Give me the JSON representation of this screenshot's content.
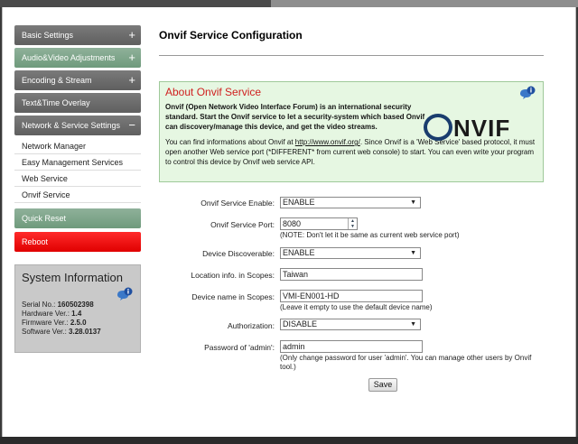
{
  "sidebar": {
    "menu": [
      {
        "label": "Basic Settings",
        "icon": "plus-icon",
        "glyph": "+"
      },
      {
        "label": "Audio&Video Adjustments",
        "icon": "plus-icon",
        "glyph": "+"
      },
      {
        "label": "Encoding & Stream",
        "icon": "plus-icon",
        "glyph": "+"
      },
      {
        "label": "Text&Time Overlay"
      },
      {
        "label": "Network & Service Settings",
        "icon": "minus-icon",
        "glyph": "−"
      }
    ],
    "submenu": [
      "Network Manager",
      "Easy Management Services",
      "Web Service",
      "Onvif Service"
    ],
    "quick_reset": "Quick Reset",
    "reboot": "Reboot"
  },
  "sysinfo": {
    "title": "System Information",
    "serial_label": "Serial No.:",
    "serial": "160502398",
    "hardware_label": "Hardware Ver.:",
    "hardware": "1.4",
    "firmware_label": "Firmware Ver.:",
    "firmware": "2.5.0",
    "software_label": "Software Ver.:",
    "software": "3.28.0137"
  },
  "main": {
    "title": "Onvif Service Configuration",
    "about": {
      "title": "About Onvif Service",
      "desc": "Onvif (Open Network Video Interface Forum) is an international security standard. Start the Onvif service to let a security-system which based Onvif can discovery/manage this device, and get the video streams.",
      "info_pre": "You can find informations about Onvif at ",
      "info_link": "http://www.onvif.org/",
      "info_post": ". Since Onvif is a 'Web Service' based protocol, it must open another Web service port (*DIFFERENT* from current web console) to start. You can even write your program to control this device by Onvif web service API.",
      "logo_rest": "NVIF"
    },
    "form": {
      "enable_label": "Onvif Service Enable:",
      "enable_value": "ENABLE",
      "port_label": "Onvif Service Port:",
      "port_value": "8080",
      "port_note": "(NOTE: Don't let it be same as current web service port)",
      "discover_label": "Device Discoverable:",
      "discover_value": "ENABLE",
      "location_label": "Location info. in Scopes:",
      "location_value": "Taiwan",
      "name_label": "Device name in Scopes:",
      "name_value": "VMI-EN001-HD",
      "name_note": "(Leave it empty to use the default device name)",
      "auth_label": "Authorization:",
      "auth_value": "DISABLE",
      "password_label": "Password of 'admin':",
      "password_value": "admin",
      "password_note": "(Only change password for user 'admin'. You can manage other users by Onvif tool.)",
      "save_label": "Save"
    }
  },
  "colors": {
    "accent_green": "#6f9a7c",
    "reboot_red": "#e00000",
    "about_bg": "#e6f7e2",
    "title_red": "#d02020",
    "onvif_blue": "#1a3d6e"
  }
}
